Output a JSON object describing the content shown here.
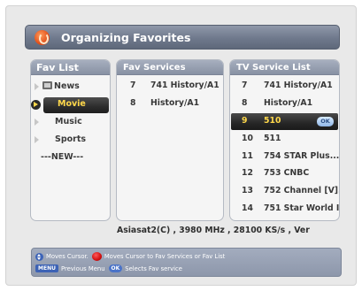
{
  "window": {
    "title": "Organizing Favorites",
    "icon": "fav-organize-icon"
  },
  "fav_list": {
    "header": "Fav List",
    "items": [
      {
        "label": "News",
        "icon": "tv-icon"
      },
      {
        "label": "Movie",
        "selected": true
      },
      {
        "label": "Music"
      },
      {
        "label": "Sports"
      },
      {
        "label": "---NEW---"
      }
    ]
  },
  "fav_services": {
    "header": "Fav Services",
    "rows": [
      {
        "num": "7",
        "name": "741 History/A1"
      },
      {
        "num": "8",
        "name": "History/A1"
      }
    ]
  },
  "tv_services": {
    "header": "TV Service List",
    "rows": [
      {
        "num": "7",
        "name": "741 History/A1"
      },
      {
        "num": "8",
        "name": "History/A1"
      },
      {
        "num": "9",
        "name": "510",
        "selected": true,
        "badge": "OK"
      },
      {
        "num": "10",
        "name": "511"
      },
      {
        "num": "11",
        "name": "754 STAR Plus..."
      },
      {
        "num": "12",
        "name": "753 CNBC"
      },
      {
        "num": "13",
        "name": "752 Channel [V]..."
      },
      {
        "num": "14",
        "name": "751 Star World I..."
      }
    ]
  },
  "satellite_info": "Asiasat2(C) , 3980 MHz , 28100 KS/s , Ver",
  "help": {
    "line1_part1": "Moves Cursor.",
    "line1_part2": "Moves Cursor to Fav Services or Fav List",
    "line2_menu_key": "MENU",
    "line2_part1": "Previous Menu",
    "line2_ok_key": "OK",
    "line2_part2": "Selects Fav service"
  },
  "colors": {
    "selected_text": "#ffd84a",
    "header_bg": "#8f98a9",
    "red_key": "#d10f0f",
    "blue_key": "#3c62b5"
  }
}
